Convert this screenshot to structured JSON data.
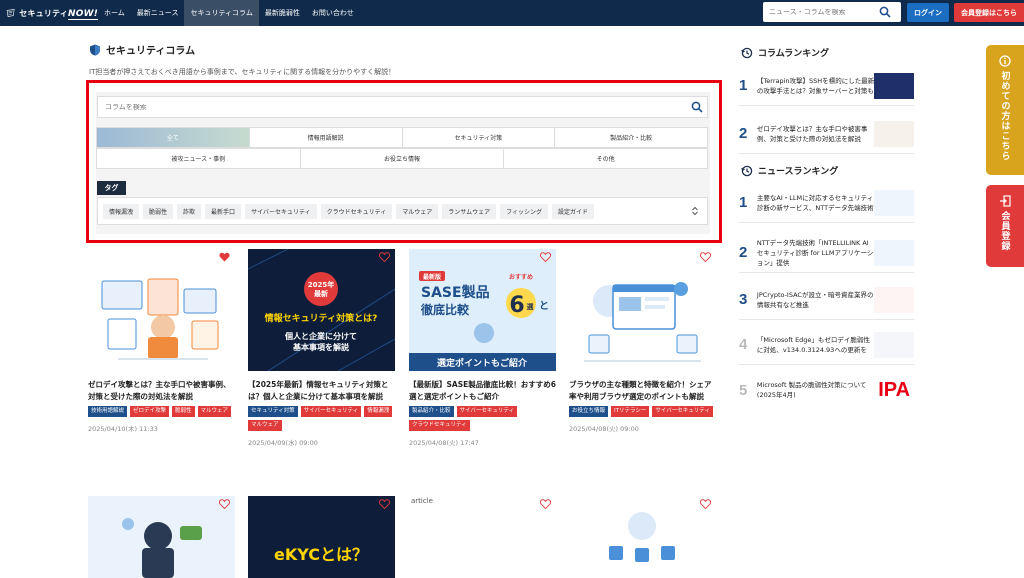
{
  "header": {
    "logo_text": "セキュリティ",
    "logo_now": "NOW!",
    "nav": [
      "ホーム",
      "最新ニュース",
      "セキュリティコラム",
      "最新脆弱性",
      "お問い合わせ"
    ],
    "search_placeholder": "ニュース・コラムを検索",
    "login_label": "ログイン",
    "register_label": "会員登録はこちら"
  },
  "page": {
    "title": "セキュリティコラム",
    "description": "IT担当者が押さえておくべき用語から事例まで、セキュリティに関する情報を分かりやすく解説！"
  },
  "filter": {
    "search_placeholder": "コラムを検索",
    "categories_row1": [
      "全て",
      "情報用語解説",
      "セキュリティ対策",
      "製品紹介・比較"
    ],
    "categories_row2": [
      "被攻ニュース・事例",
      "お役立ち情報",
      "その他"
    ],
    "tag_title": "タグ",
    "tags": [
      "情報漏洩",
      "脆弱性",
      "詐欺",
      "最新手口",
      "サイバーセキュリティ",
      "クラウドセキュリティ",
      "マルウェア",
      "ランサムウェア",
      "フィッシング",
      "設定ガイド"
    ]
  },
  "cards": [
    {
      "title": "ゼロデイ攻撃とは？主な手口や被害事例、対策と受けた際の対処法を解説",
      "tags": [
        {
          "label": "技術用語解説",
          "color": "blue"
        },
        {
          "label": "ゼロデイ攻撃",
          "color": "red"
        },
        {
          "label": "脆弱性",
          "color": "red"
        },
        {
          "label": "マルウェア",
          "color": "red"
        }
      ],
      "date": "2025/04/10(木) 11:33",
      "favorited": true
    },
    {
      "title": "【2025年最新】情報セキュリティ対策とは？個人と企業に分けて基本事項を解説",
      "tags": [
        {
          "label": "セキュリティ対策",
          "color": "blue"
        },
        {
          "label": "サイバーセキュリティ",
          "color": "red"
        },
        {
          "label": "情報漏洩",
          "color": "red"
        },
        {
          "label": "マルウェア",
          "color": "red"
        }
      ],
      "date": "2025/04/09(水) 09:00",
      "favorited": false,
      "image_text": [
        "2025年",
        "最新",
        "情報セキュリティ対策とは?",
        "個人と企業に分けて",
        "基本事項を解説"
      ]
    },
    {
      "title": "【最新版】SASE製品徹底比較！おすすめ6選と選定ポイントもご紹介",
      "tags": [
        {
          "label": "製品紹介・比較",
          "color": "blue"
        },
        {
          "label": "サイバーセキュリティ",
          "color": "red"
        },
        {
          "label": "クラウドセキュリティ",
          "color": "red"
        }
      ],
      "date": "2025/04/08(火) 17:47",
      "favorited": false,
      "image_text": [
        "最新版",
        "おすすめ",
        "SASE製品",
        "徹底比較",
        "6",
        "選",
        "と",
        "選定ポイントもご紹介"
      ]
    },
    {
      "title": "ブラウザの主な種類と特徴を紹介！シェア率や利用ブラウザ選定のポイントも解説",
      "tags": [
        {
          "label": "お役立ち情報",
          "color": "blue"
        },
        {
          "label": "ITリテラシー",
          "color": "red"
        },
        {
          "label": "サイバーセキュリティ",
          "color": "red"
        }
      ],
      "date": "2025/04/08(火) 09:00",
      "favorited": false
    }
  ],
  "cards_row2": [
    {
      "image_text": ""
    },
    {
      "image_text": "eKYCとは？"
    },
    {
      "image_text": "article"
    },
    {
      "image_text": ""
    }
  ],
  "column_ranking": {
    "title": "コラムランキング",
    "items": [
      {
        "rank": "1",
        "text": "【Terrapin攻撃】SSHを標的にした最新の攻撃手法とは？対象サーバーと対策も"
      },
      {
        "rank": "2",
        "text": "ゼロデイ攻撃とは？主な手口や被害事例、対策と受けた際の対処法を解説"
      }
    ]
  },
  "news_ranking": {
    "title": "ニュースランキング",
    "items": [
      {
        "rank": "1",
        "text": "主要なAI・LLMに対応するセキュリティ診断の新サービス、NTTデータ先端技術"
      },
      {
        "rank": "2",
        "text": "NTTデータ先端技術「INTELLILINK AIセキュリティ診断 for LLMアプリケーション」提供"
      },
      {
        "rank": "3",
        "text": "JPCrypto-ISACが設立・暗号資産業界の情報共有など推進"
      },
      {
        "rank": "4",
        "text": "「Microsoft Edge」もゼロデイ脆弱性に対処、v134.0.3124.93への更新を"
      },
      {
        "rank": "5",
        "text": "Microsoft 製品の脆弱性対策について(2025年4月)",
        "thumb_text": "IPA"
      }
    ]
  },
  "side_tabs": {
    "first_time": "初めての方はこちら",
    "register": "会員登録"
  },
  "colors": {
    "header_bg": "#0f2a4a",
    "accent_blue": "#1e4f8a",
    "accent_red": "#e03a3a",
    "side_yellow": "#d8a31d",
    "highlight_frame": "#e60012"
  }
}
